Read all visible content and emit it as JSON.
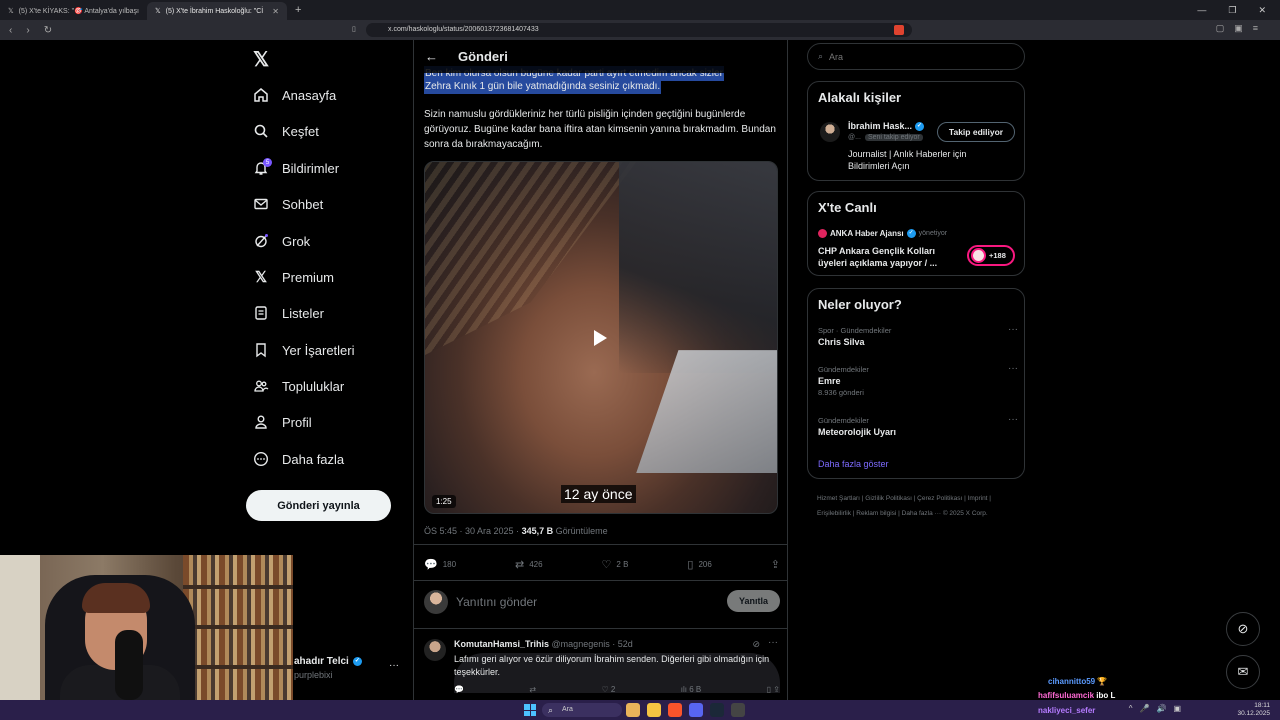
{
  "browser": {
    "tabs": [
      {
        "label": "(5) X'te KİYAKS: \"🎯 Antalya'da yılbaşı"
      },
      {
        "label": "(5) X'te İbrahim Haskoloğlu: \"Cİ"
      }
    ],
    "new_tab": "+",
    "url": "x.com/haskologlu/status/2006013723681407433"
  },
  "left_nav": {
    "items": [
      {
        "label": "Anasayfa",
        "icon": "home-icon"
      },
      {
        "label": "Keşfet",
        "icon": "search-icon"
      },
      {
        "label": "Bildirimler",
        "icon": "bell-icon",
        "badge": "5"
      },
      {
        "label": "Sohbet",
        "icon": "mail-icon"
      },
      {
        "label": "Grok",
        "icon": "grok-icon"
      },
      {
        "label": "Premium",
        "icon": "x-logo-icon"
      },
      {
        "label": "Listeler",
        "icon": "list-icon"
      },
      {
        "label": "Yer İşaretleri",
        "icon": "bookmark-icon"
      },
      {
        "label": "Topluluklar",
        "icon": "communities-icon"
      },
      {
        "label": "Profil",
        "icon": "profile-icon"
      },
      {
        "label": "Daha fazla",
        "icon": "more-circle-icon"
      }
    ],
    "post_button": "Gönderi yayınla",
    "account": {
      "name": "ahadır Telci",
      "handle": "purplebixi",
      "more": "···"
    }
  },
  "post": {
    "header_title": "Gönderi",
    "highlighted_line1": "Ben kim olursa olsun bugüne kadar parti ayırt etmedim ancak sizler",
    "highlighted_line2": "Zehra Kınık 1 gün bile yatmadığında sesiniz çıkmadı.",
    "body": "Sizin namuslu gördükleriniz her türlü pisliğin içinden geçtiğini bugünlerde görüyoruz. Bugüne kadar bana iftira atan kimsenin yanına bırakmadım. Bundan sonra da bırakmayacağım.",
    "video": {
      "subtitle": "12 ay önce",
      "duration": "1:25"
    },
    "time": "ÖS 5:45 · 30 Ara 2025 · ",
    "views": "345,7 B",
    "views_label": " Görüntüleme",
    "actions": {
      "replies": "180",
      "reposts": "426",
      "likes": "2 B",
      "bookmarks": "206"
    },
    "reply_placeholder": "Yanıtını gönder",
    "reply_button": "Yanıtla"
  },
  "reply": {
    "name": "KomutanHamsi_Trihis",
    "handle": "@magnegenis · 52d",
    "more": "···",
    "text": "Lafımı geri alıyor ve özür diliyorum İbrahim senden. Diğerleri gibi olmadığın için teşekkürler.",
    "actions": {
      "replies": "",
      "reposts": "",
      "likes": "2",
      "views": "6 B"
    }
  },
  "right": {
    "search_placeholder": "Ara",
    "related": {
      "title": "Alakalı kişiler",
      "name": "İbrahim Hask...",
      "handle": "@...",
      "follows_you": "Seni takip ediyor",
      "follow_button": "Takip ediliyor",
      "bio": "Journalist | Anlık Haberler için Bildirimleri Açın"
    },
    "live": {
      "title": "X'te Canlı",
      "source": "ANKA Haber Ajansı",
      "source_suffix": "yönetiyor",
      "headline": "CHP Ankara Gençlik Kolları üyeleri açıklama yapıyor / ...",
      "listeners": "+188"
    },
    "trends": {
      "title": "Neler oluyor?",
      "items": [
        {
          "category": "Spor · Gündemdekiler",
          "name": "Chris Silva",
          "count": ""
        },
        {
          "category": "Gündemdekiler",
          "name": "Emre",
          "count": "8.936 gönderi"
        },
        {
          "category": "Gündemdekiler",
          "name": "Meteorolojik Uyarı",
          "count": ""
        }
      ],
      "show_more": "Daha fazla göster"
    },
    "footer": "Hizmet Şartları | Gizlilik Politikası | Çerez Politikası | Imprint | Erişilebilirlik | Reklam bilgisi | Daha fazla ··· © 2025 X Corp."
  },
  "chat": [
    {
      "user": "cihannitto59",
      "msg": "🏆",
      "color": "#5b9bff"
    },
    {
      "user": "hafifsuluamcik",
      "msg": "ibo L",
      "color": "#ff6ad5"
    },
    {
      "user": "nakliyeci_sefer",
      "msg": "",
      "color": "#b57bff"
    }
  ],
  "taskbar": {
    "search": "Ara",
    "time": "18:11",
    "date": "30.12.2025"
  }
}
